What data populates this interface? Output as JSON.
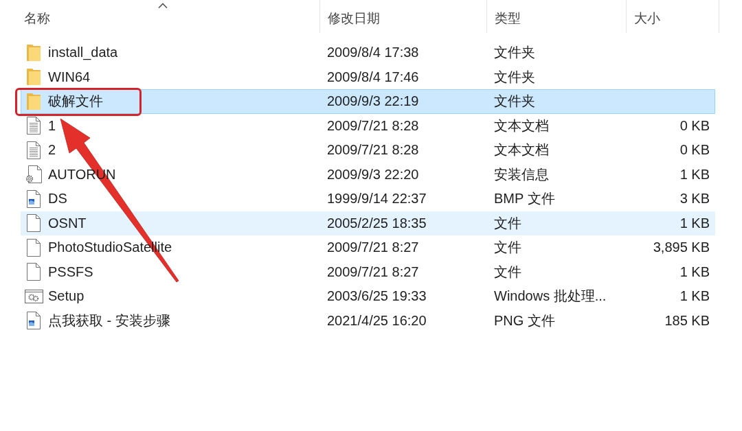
{
  "columns": [
    {
      "label": "名称",
      "sorted": true
    },
    {
      "label": "修改日期",
      "sorted": false
    },
    {
      "label": "类型",
      "sorted": false
    },
    {
      "label": "大小",
      "sorted": false
    }
  ],
  "rows": [
    {
      "kind": "folder",
      "name": "install_data",
      "modified": "2009/8/4 17:38",
      "type": "文件夹",
      "selected": false,
      "hovered": false,
      "marked": false
    },
    {
      "kind": "folder",
      "name": "WIN64",
      "modified": "2009/8/4 17:46",
      "type": "文件夹",
      "selected": false,
      "hovered": false,
      "marked": false
    },
    {
      "kind": "folder",
      "name": "破解文件",
      "modified": "2009/9/3 22:19",
      "type": "文件夹",
      "selected": true,
      "hovered": false,
      "marked": true
    },
    {
      "kind": "text",
      "name": "1",
      "modified": "2009/7/21 8:28",
      "type": "文本文档",
      "size": "0 KB",
      "selected": false,
      "hovered": false,
      "marked": false
    },
    {
      "kind": "text",
      "name": "2",
      "modified": "2009/7/21 8:28",
      "type": "文本文档",
      "size": "0 KB",
      "selected": false,
      "hovered": false,
      "marked": false
    },
    {
      "kind": "settings",
      "name": "AUTORUN",
      "modified": "2009/9/3 22:20",
      "type": "安装信息",
      "size": "1 KB",
      "selected": false,
      "hovered": false,
      "marked": false
    },
    {
      "kind": "image",
      "name": "DS",
      "modified": "1999/9/14 22:37",
      "type": "BMP 文件",
      "size": "3 KB",
      "selected": false,
      "hovered": false,
      "marked": false
    },
    {
      "kind": "blank",
      "name": "OSNT",
      "modified": "2005/2/25 18:35",
      "type": "文件",
      "size": "1 KB",
      "selected": false,
      "hovered": true,
      "marked": false
    },
    {
      "kind": "blank",
      "name": "PhotoStudioSatellite",
      "modified": "2009/7/21 8:27",
      "type": "文件",
      "size": "3,895 KB",
      "selected": false,
      "hovered": false,
      "marked": false
    },
    {
      "kind": "blank",
      "name": "PSSFS",
      "modified": "2009/7/21 8:27",
      "type": "文件",
      "size": "1 KB",
      "selected": false,
      "hovered": false,
      "marked": false
    },
    {
      "kind": "batch",
      "name": "Setup",
      "modified": "2003/6/25 19:33",
      "type": "Windows 批处理...",
      "size": "1 KB",
      "selected": false,
      "hovered": false,
      "marked": false
    },
    {
      "kind": "image",
      "name": "点我获取 - 安装步骤",
      "modified": "2021/4/25 16:20",
      "type": "PNG 文件",
      "size": "185 KB",
      "selected": false,
      "hovered": false,
      "marked": false
    }
  ]
}
